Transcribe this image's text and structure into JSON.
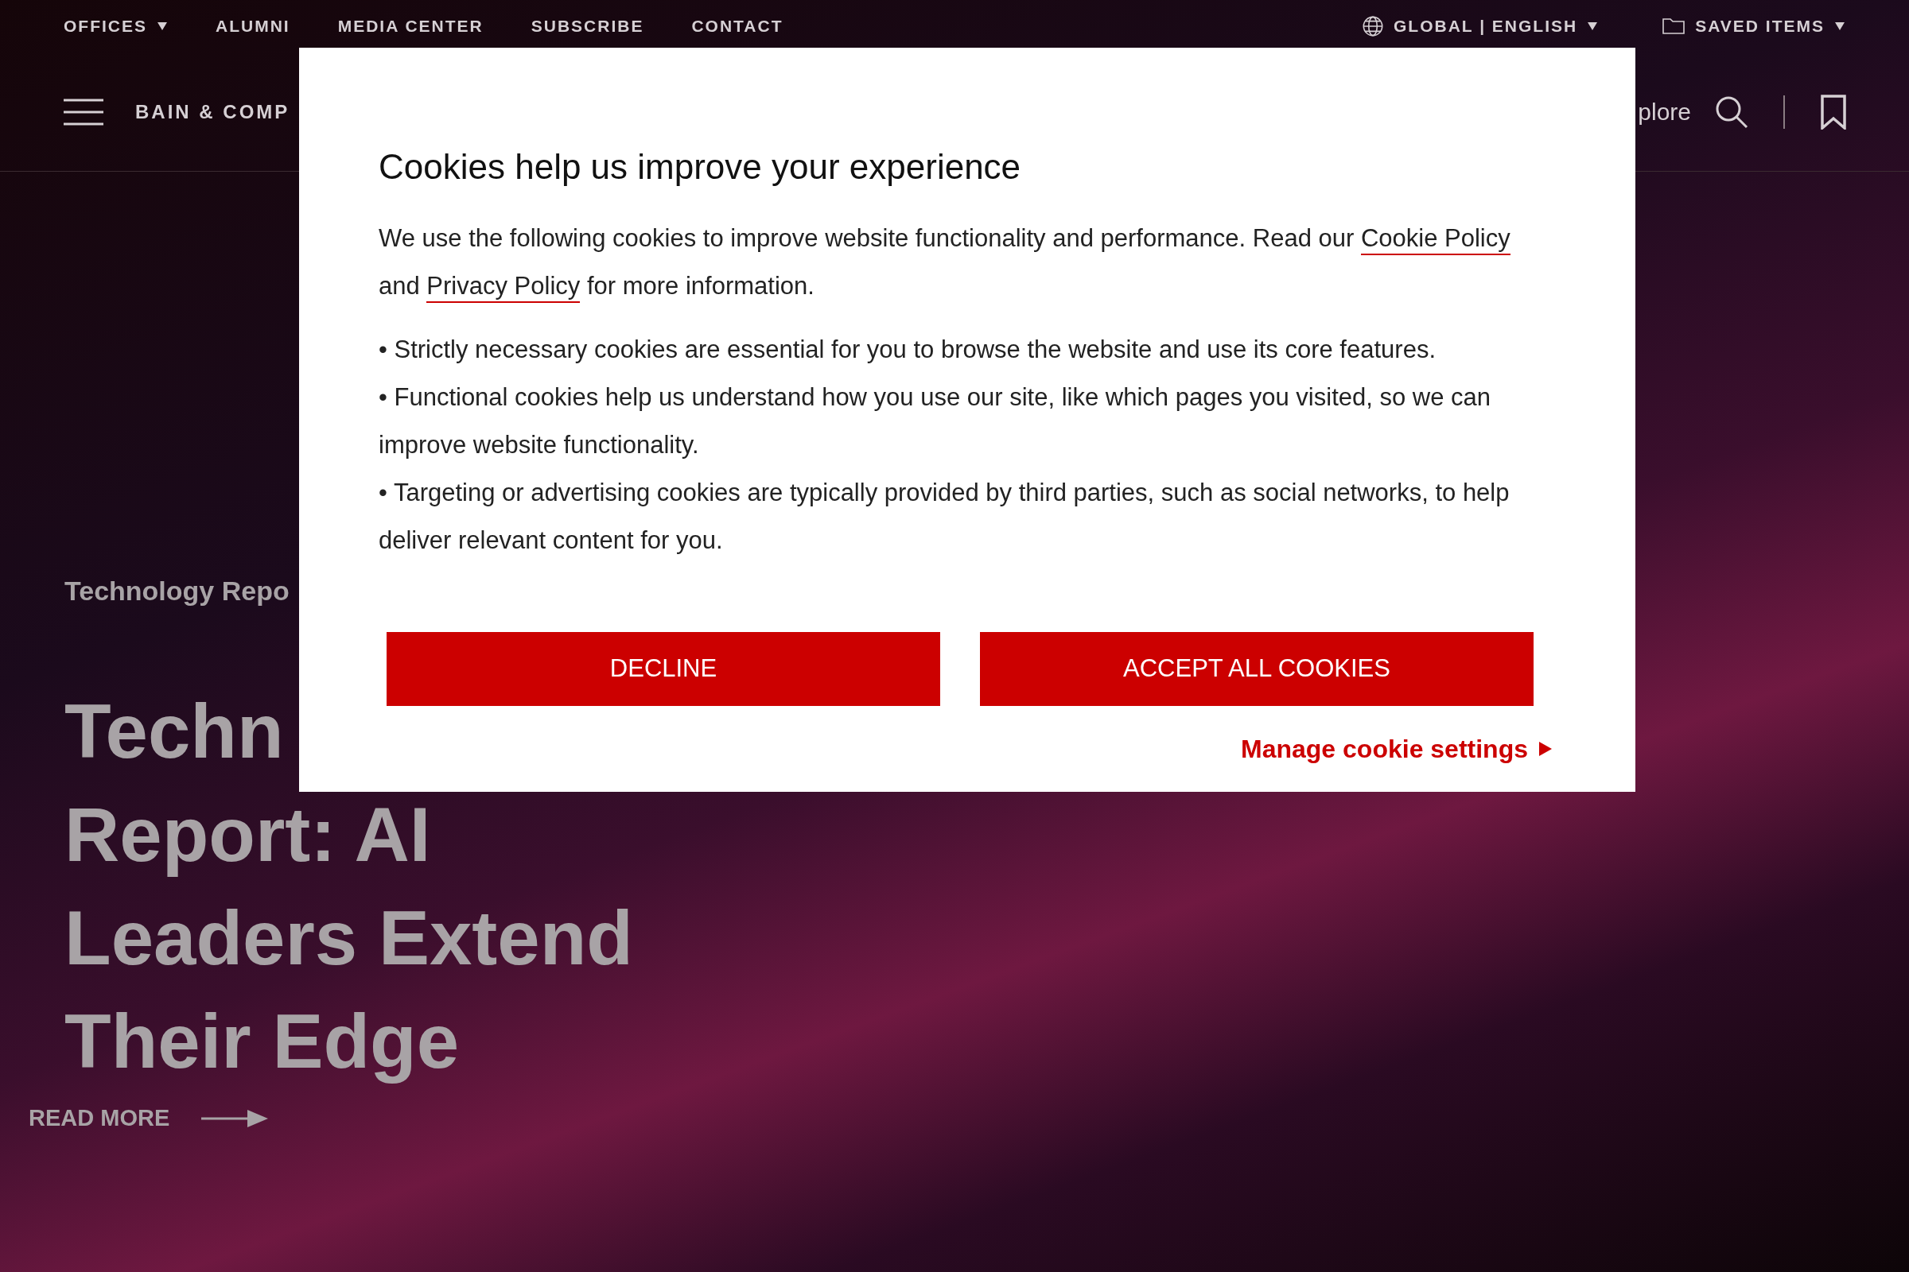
{
  "top_bar": {
    "left_links": [
      {
        "label": "OFFICES",
        "dropdown": true
      },
      {
        "label": "ALUMNI",
        "dropdown": false
      },
      {
        "label": "MEDIA CENTER",
        "dropdown": false
      },
      {
        "label": "SUBSCRIBE",
        "dropdown": false
      },
      {
        "label": "CONTACT",
        "dropdown": false
      }
    ],
    "right_links": [
      {
        "label": "GLOBAL | ENGLISH",
        "kind": "globe"
      },
      {
        "label": "SAVED ITEMS",
        "kind": "folder"
      }
    ]
  },
  "nav": {
    "logo": "BAIN & COMP",
    "explore": "plore"
  },
  "hero": {
    "eyebrow": "Technology Repo",
    "headline_lines": [
      "Techn",
      "Report: AI",
      "Leaders Extend",
      "Their Edge"
    ],
    "read_more": "READ MORE"
  },
  "cookie_dialog": {
    "title": "Cookies help us improve your experience",
    "intro": [
      {
        "text": "We use the following cookies to improve website functionality and performance. Read our ",
        "link": false
      },
      {
        "text": "Cookie Policy",
        "link": true
      },
      {
        "text": " and ",
        "link": false
      },
      {
        "text": "Privacy Policy",
        "link": true
      },
      {
        "text": " for more information.",
        "link": false
      }
    ],
    "bullets": [
      "• Strictly necessary cookies are essential for you to browse the website and use its core features.",
      "• Functional cookies help us understand how you use our site, like which pages you visited, so we can improve website functionality.",
      "• Targeting or advertising cookies are typically provided by third parties, such as social networks, to help deliver relevant content for you."
    ],
    "buttons": [
      "DECLINE",
      "ACCEPT ALL COOKIES"
    ],
    "manage_link": "Manage cookie settings"
  }
}
